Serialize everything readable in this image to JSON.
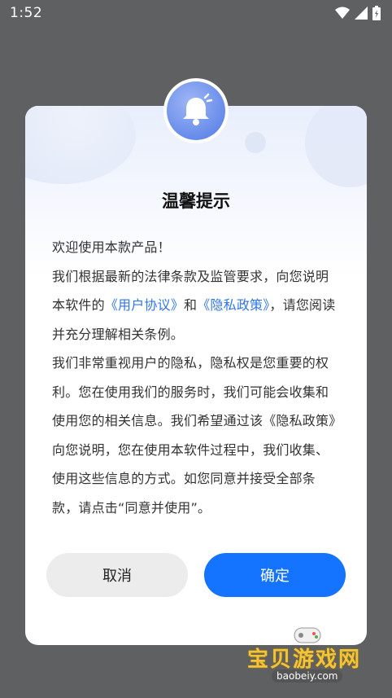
{
  "status_bar": {
    "time": "1:52"
  },
  "dialog": {
    "title": "温馨提示",
    "line1": "欢迎使用本款产品！",
    "line2a": "我们根据最新的法律条款及监管要求，向您",
    "line2b": "说明本软件的",
    "link_user": "《用户协议》",
    "and": "和",
    "link_privacy": "《隐私政策》",
    "line2c": "，请您阅读并充分理解相关条例。",
    "line3": "我们非常重视用户的隐私，隐私权是您重要的权利。您在使用我们的服务时，我们可能会收集和使用您的相关信息。我们希望通过该《隐私政策》向您说明，您在使用本软件过程中，我们收集、使用这些信息的方式。如您同意并接受全部条款，请点击“同意并使用”。",
    "cancel_label": "取消",
    "ok_label": "确定"
  },
  "watermark": {
    "text": "宝贝游戏网",
    "url": "baobeiy.com"
  },
  "colors": {
    "link": "#2f76e8",
    "primary": "#1473ff",
    "overlay": "#5e6062"
  }
}
